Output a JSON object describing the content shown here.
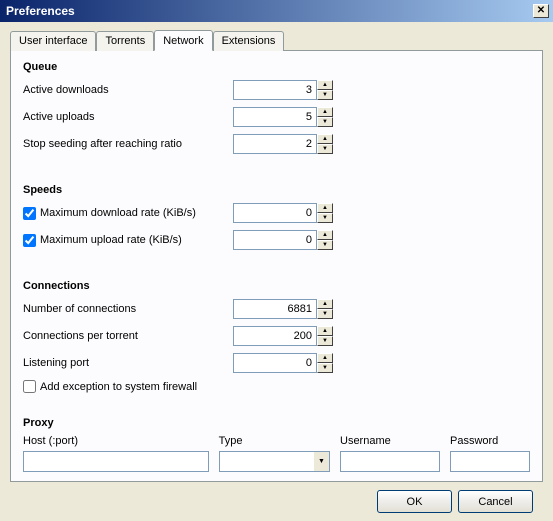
{
  "window": {
    "title": "Preferences"
  },
  "tabs": {
    "user_interface": "User interface",
    "torrents": "Torrents",
    "network": "Network",
    "extensions": "Extensions",
    "active": "network"
  },
  "sections": {
    "queue": {
      "title": "Queue",
      "active_downloads": {
        "label": "Active downloads",
        "value": "3"
      },
      "active_uploads": {
        "label": "Active uploads",
        "value": "5"
      },
      "stop_seeding_ratio": {
        "label": "Stop seeding after reaching ratio",
        "value": "2"
      }
    },
    "speeds": {
      "title": "Speeds",
      "max_download": {
        "label": "Maximum download rate (KiB/s)",
        "value": "0",
        "checked": true
      },
      "max_upload": {
        "label": "Maximum upload rate (KiB/s)",
        "value": "0",
        "checked": true
      }
    },
    "connections": {
      "title": "Connections",
      "num_connections": {
        "label": "Number of connections",
        "value": "6881"
      },
      "conn_per_torrent": {
        "label": "Connections per torrent",
        "value": "200"
      },
      "listening_port": {
        "label": "Listening port",
        "value": "0"
      },
      "firewall": {
        "label": "Add exception to system firewall",
        "checked": false
      }
    },
    "proxy": {
      "title": "Proxy",
      "host": {
        "label": "Host (:port)",
        "value": ""
      },
      "type": {
        "label": "Type",
        "value": ""
      },
      "username": {
        "label": "Username",
        "value": ""
      },
      "password": {
        "label": "Password",
        "value": ""
      }
    }
  },
  "buttons": {
    "ok": "OK",
    "cancel": "Cancel"
  }
}
